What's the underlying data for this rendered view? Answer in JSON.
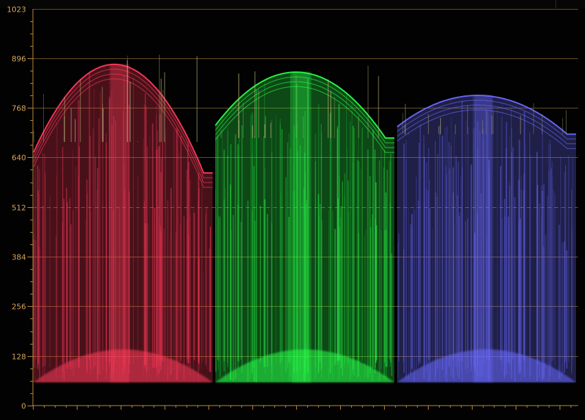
{
  "chart_data": {
    "type": "heatmap",
    "title": "",
    "xlabel": "",
    "ylabel": "",
    "ylim": [
      0,
      1023
    ],
    "y_ticks": [
      {
        "value": 1023,
        "label": "1023"
      },
      {
        "value": 896,
        "label": "896"
      },
      {
        "value": 768,
        "label": "768"
      },
      {
        "value": 640,
        "label": "640"
      },
      {
        "value": 512,
        "label": "512"
      },
      {
        "value": 384,
        "label": "384"
      },
      {
        "value": 256,
        "label": "256"
      },
      {
        "value": 128,
        "label": "128"
      },
      {
        "value": 0,
        "label": "0"
      }
    ],
    "dashed_gridline_value": 512,
    "grid": true,
    "series": [
      {
        "name": "",
        "color": "#ff3a5a",
        "values": [
          60,
          880,
          600,
          920,
          680
        ]
      },
      {
        "name": "",
        "color": "#2aff4a",
        "values": [
          60,
          860,
          690,
          880,
          690
        ]
      },
      {
        "name": "",
        "color": "#6a6aff",
        "values": [
          60,
          800,
          700,
          790,
          700
        ]
      }
    ]
  },
  "colors": {
    "background": "#020202",
    "tick_label": "#d6a35a",
    "gridline": "#6a5220"
  }
}
